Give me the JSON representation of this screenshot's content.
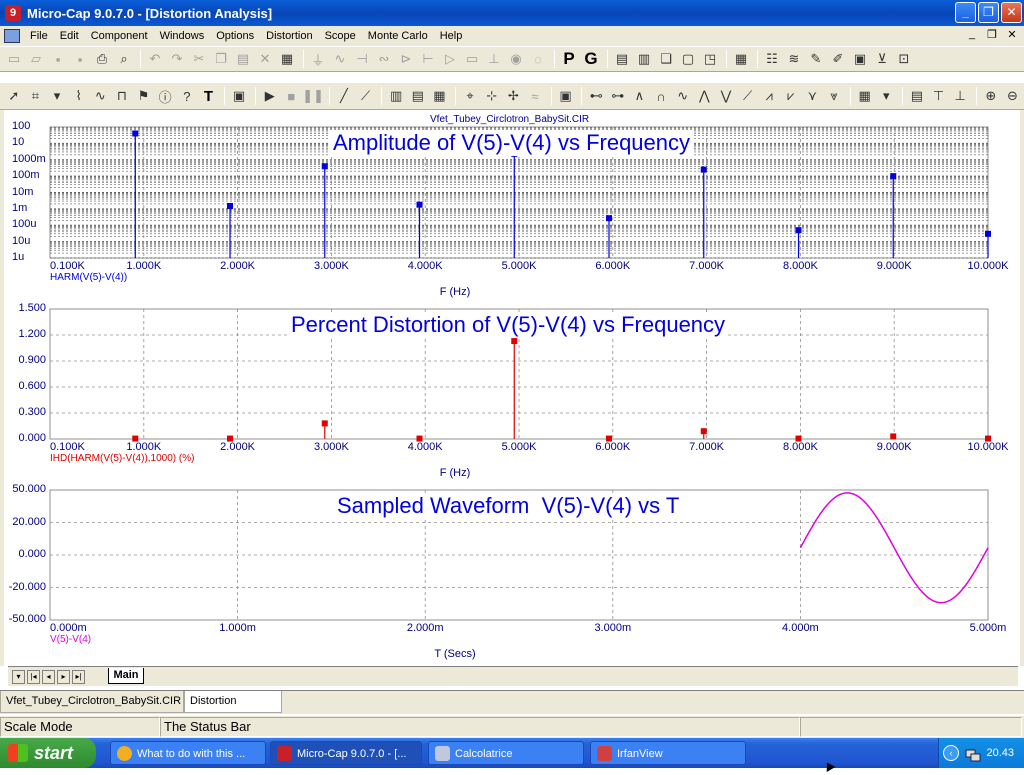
{
  "window": {
    "title": "Micro-Cap 9.0.7.0 - [Distortion Analysis]",
    "app_icon_letter": "9",
    "minimize_glyph": "_",
    "restore_glyph": "❐",
    "close_glyph": "✕"
  },
  "menu": {
    "items": [
      "File",
      "Edit",
      "Component",
      "Windows",
      "Options",
      "Distortion",
      "Scope",
      "Monte Carlo",
      "Help"
    ],
    "mdi_controls": [
      "_",
      "❐",
      "✕"
    ]
  },
  "toolbar1": {
    "icons": [
      "new-file-icon",
      "open-file-icon",
      "save-icon",
      "save-all-icon",
      "print-icon",
      "print-preview-icon",
      "undo-icon",
      "redo-icon",
      "cut-icon",
      "copy-icon",
      "paste-icon",
      "delete-icon",
      "select-all-icon",
      "ground-icon",
      "resistor-icon",
      "capacitor-icon",
      "inductor-icon",
      "diode-icon",
      "battery-icon",
      "opamp-icon",
      "fuse-icon",
      "transformer-icon",
      "source-icon",
      "bulb-icon"
    ],
    "letters": [
      "P",
      "G"
    ]
  },
  "chart_data": [
    {
      "type": "bar",
      "title": "Amplitude of V(5)-V(4) vs Frequency",
      "xlabel": "F (Hz)",
      "ylabel": "HARM(V(5)-V(4))",
      "scale": "log",
      "x_ticks": [
        "0.100K",
        "1.000K",
        "2.000K",
        "3.000K",
        "4.000K",
        "5.000K",
        "6.000K",
        "7.000K",
        "8.000K",
        "9.000K",
        "10.000K"
      ],
      "y_ticks": [
        "100",
        "10",
        "1000m",
        "100m",
        "10m",
        "1m",
        "100u",
        "10u",
        "1u"
      ],
      "xlim": [
        0.1,
        10
      ],
      "ylim": [
        1e-06,
        100
      ],
      "x": [
        1,
        2,
        3,
        4,
        5,
        6,
        7,
        8,
        9,
        10
      ],
      "values": [
        40,
        0.0015,
        0.4,
        0.0018,
        2.3,
        0.00027,
        0.25,
        5e-05,
        0.1,
        3e-05
      ],
      "color": "#0000e0"
    },
    {
      "type": "bar",
      "title": "Percent Distortion of V(5)-V(4) vs Frequency",
      "xlabel": "F (Hz)",
      "ylabel": "IHD(HARM(V(5)-V(4)),1000) (%)",
      "x_ticks": [
        "0.100K",
        "1.000K",
        "2.000K",
        "3.000K",
        "4.000K",
        "5.000K",
        "6.000K",
        "7.000K",
        "8.000K",
        "9.000K",
        "10.000K"
      ],
      "y_ticks": [
        "1.500",
        "1.200",
        "0.900",
        "0.600",
        "0.300",
        "0.000"
      ],
      "xlim": [
        0.1,
        10
      ],
      "ylim": [
        0,
        1.5
      ],
      "x": [
        1,
        2,
        3,
        4,
        5,
        6,
        7,
        8,
        9,
        10
      ],
      "values": [
        0.005,
        0.005,
        0.18,
        0.005,
        1.13,
        0.005,
        0.09,
        0.005,
        0.03,
        0.005
      ],
      "color": "#e00000"
    },
    {
      "type": "line",
      "title": "Sampled Waveform  V(5)-V(4) vs T",
      "xlabel": "T (Secs)",
      "ylabel": "V(5)-V(4)",
      "x_ticks": [
        "0.000m",
        "1.000m",
        "2.000m",
        "3.000m",
        "4.000m",
        "5.000m"
      ],
      "y_ticks": [
        "50.000",
        "20.000",
        "0.000",
        "-20.000",
        "-50.000"
      ],
      "xlim": [
        0,
        5
      ],
      "ylim": [
        -50,
        40
      ],
      "series": [
        {
          "t_start": 4.0,
          "t_end": 5.0,
          "amplitude": 38,
          "frequency_khz": 1
        }
      ],
      "color": "#e000e0"
    }
  ],
  "circuit_file": "Vfet_Tubey_Circlotron_BabySit.CIR",
  "page_tab": "Main",
  "doc_tabs": [
    "Vfet_Tubey_Circlotron_BabySit.CIR",
    "Distortion Analysis"
  ],
  "status": {
    "mode": "Scale Mode",
    "message": "The Status Bar"
  },
  "taskbar": {
    "start": "start",
    "tasks": [
      {
        "label": "What to do with this ...",
        "color": "#f2b020"
      },
      {
        "label": "Micro-Cap 9.0.7.0 - [...",
        "color": "#c8202a"
      },
      {
        "label": "Calcolatrice",
        "color": "#c0c8e0"
      },
      {
        "label": "IrfanView",
        "color": "#d04040"
      }
    ],
    "clock": "20.43"
  }
}
